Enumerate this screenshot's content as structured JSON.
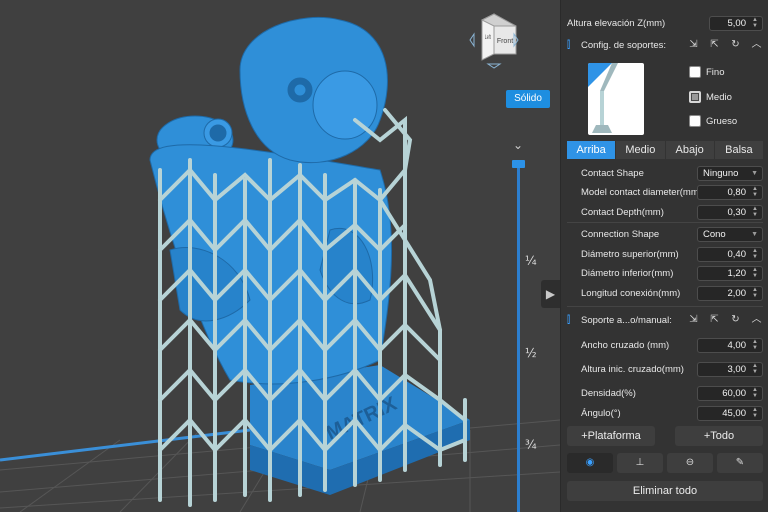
{
  "viewport": {
    "view_cube": {
      "front_label": "Front",
      "left_label": "Left"
    },
    "render_mode_label": "Sólido",
    "layer_ticks": [
      "¼",
      "½",
      "¾"
    ],
    "model_watermark": "MATRIX",
    "colors": {
      "model": "#2f8fd8",
      "supports": "#b7d3d6",
      "background": "#404040",
      "accent": "#2f93e6"
    }
  },
  "panel": {
    "lift_height": {
      "label": "Altura elevación Z(mm)",
      "value": "5,00"
    },
    "support_config": {
      "title": "Config. de soportes:",
      "icons": [
        "import-icon",
        "export-icon",
        "reset-icon",
        "collapse-icon"
      ],
      "presets": [
        {
          "label": "Fino",
          "checked": false
        },
        {
          "label": "Medio",
          "checked": true
        },
        {
          "label": "Grueso",
          "checked": false
        }
      ],
      "tabs": [
        {
          "label": "Arriba",
          "active": true
        },
        {
          "label": "Medio",
          "active": false
        },
        {
          "label": "Abajo",
          "active": false
        },
        {
          "label": "Balsa",
          "active": false
        }
      ],
      "fields": [
        {
          "label": "Contact Shape",
          "type": "select",
          "value": "Ninguno"
        },
        {
          "label": "Model contact diameter(mm)",
          "type": "number",
          "value": "0,80"
        },
        {
          "label": "Contact Depth(mm)",
          "type": "number",
          "value": "0,30"
        },
        {
          "label": "Connection Shape",
          "type": "select",
          "value": "Cono"
        },
        {
          "label": "Diámetro superior(mm)",
          "type": "number",
          "value": "0,40"
        },
        {
          "label": "Diámetro inferior(mm)",
          "type": "number",
          "value": "1,20"
        },
        {
          "label": "Longitud conexión(mm)",
          "type": "number",
          "value": "2,00"
        }
      ]
    },
    "manual_support": {
      "title": "Soporte a...o/manual:",
      "icons": [
        "import-icon",
        "export-icon",
        "reset-icon",
        "collapse-icon"
      ],
      "fields": [
        {
          "label": "Ancho cruzado (mm)",
          "value": "4,00"
        },
        {
          "label": "Altura inic. cruzado(mm)",
          "value": "3,00"
        },
        {
          "label": "Densidad(%)",
          "value": "60,00"
        },
        {
          "label": "Ángulo(°)",
          "value": "45,00"
        }
      ]
    },
    "buttons": {
      "add_platform": "+Plataforma",
      "add_all": "+Todo",
      "delete_all": "Eliminar todo"
    },
    "tools": [
      "eye-icon",
      "support-add-icon",
      "support-remove-icon",
      "support-edit-icon"
    ]
  }
}
